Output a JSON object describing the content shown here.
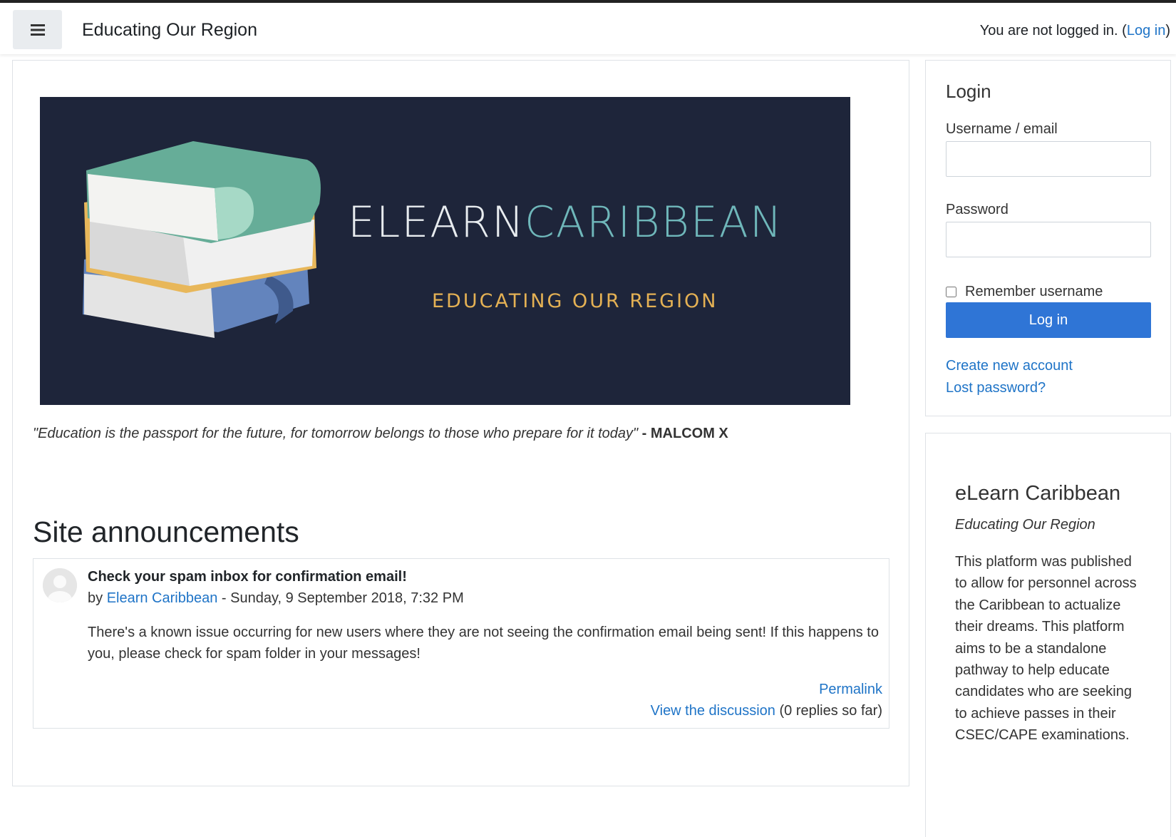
{
  "header": {
    "menu_icon": "hamburger-menu-icon",
    "site_title": "Educating Our Region",
    "login_status_prefix": "You are not logged in. (",
    "login_link": "Log in",
    "login_status_suffix": ")"
  },
  "banner": {
    "title_part1": "ELEARN",
    "title_part2": "CARIBBEAN",
    "tagline": "EDUCATING OUR REGION",
    "colors": {
      "background": "#1e253a",
      "title_white": "#e8ecef",
      "title_teal": "#6fb7ba",
      "tagline_gold": "#e4b154",
      "book_teal": "#66ad98",
      "book_gold": "#e8b75a",
      "book_blue": "#6384bd"
    }
  },
  "quote": {
    "text": "\"Education is the passport for the future, for tomorrow belongs to those who prepare for it today\"",
    "author": " - MALCOM X"
  },
  "announcements": {
    "heading": "Site announcements",
    "post": {
      "subject": "Check your spam inbox for confirmation email!",
      "by_prefix": "by ",
      "author": "Elearn Caribbean",
      "date": " - Sunday, 9 September 2018, 7:32 PM",
      "body": "There's a known issue occurring for new users where they are not seeing the confirmation email being sent! If this happens to you, please check for spam folder in your messages!",
      "permalink": "Permalink",
      "view_discussion": "View the discussion",
      "replies": " (0 replies so far)"
    }
  },
  "login_block": {
    "title": "Login",
    "username_label": "Username / email",
    "username_value": "",
    "password_label": "Password",
    "password_value": "",
    "remember_label": "Remember username",
    "remember_checked": false,
    "login_button": "Log in",
    "create_account": "Create new account",
    "lost_password": "Lost password?"
  },
  "about_block": {
    "title": "eLearn Caribbean",
    "subtitle": "Educating Our Region",
    "text": "This platform was published to allow for personnel across the Caribbean to actualize their dreams. This platform aims to be a standalone pathway to help educate candidates who are seeking to achieve passes in their CSEC/CAPE examinations."
  },
  "theme": {
    "link_color": "#1f74c7",
    "button_color": "#2f75d6",
    "border_color": "#dee2e6"
  }
}
